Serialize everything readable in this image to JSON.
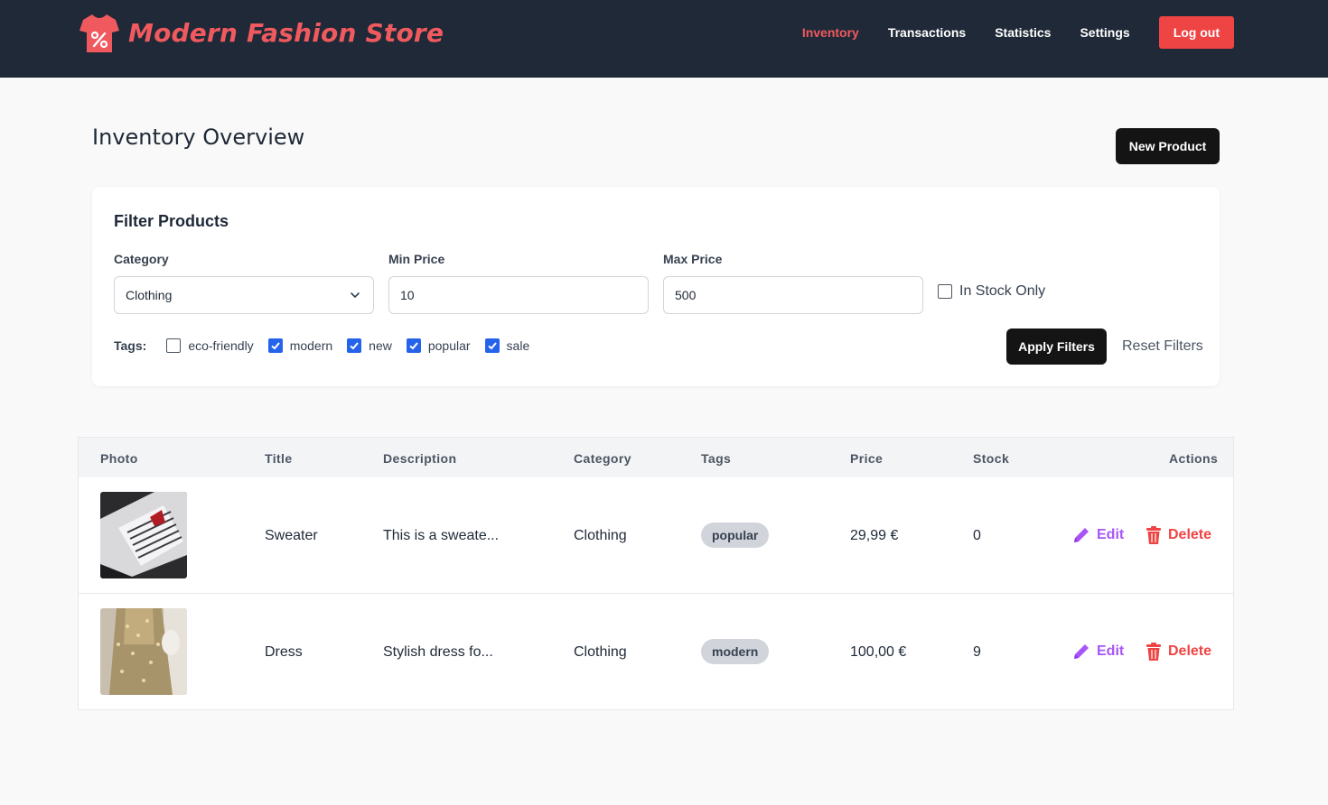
{
  "brand": {
    "name": "Modern Fashion Store",
    "accent": "#f05a5f"
  },
  "nav": {
    "items": [
      {
        "label": "Inventory",
        "active": true
      },
      {
        "label": "Transactions"
      },
      {
        "label": "Statistics"
      },
      {
        "label": "Settings"
      }
    ],
    "logout_label": "Log out"
  },
  "page": {
    "title": "Inventory Overview",
    "new_product_label": "New Product"
  },
  "filters": {
    "title": "Filter Products",
    "category": {
      "label": "Category",
      "value": "Clothing"
    },
    "min_price": {
      "label": "Min Price",
      "value": "10"
    },
    "max_price": {
      "label": "Max Price",
      "value": "500"
    },
    "in_stock": {
      "label": "In Stock Only",
      "checked": false
    },
    "tags_label": "Tags:",
    "tags": [
      {
        "label": "eco-friendly",
        "checked": false
      },
      {
        "label": "modern",
        "checked": true
      },
      {
        "label": "new",
        "checked": true
      },
      {
        "label": "popular",
        "checked": true
      },
      {
        "label": "sale",
        "checked": true
      }
    ],
    "apply_label": "Apply Filters",
    "reset_label": "Reset Filters"
  },
  "table": {
    "headers": {
      "photo": "Photo",
      "title": "Title",
      "description": "Description",
      "category": "Category",
      "tags": "Tags",
      "price": "Price",
      "stock": "Stock",
      "actions": "Actions"
    },
    "rows": [
      {
        "title": "Sweater",
        "description": "This is a sweate...",
        "category": "Clothing",
        "tag": "popular",
        "price": "29,99 €",
        "stock": "0",
        "photo": "folded-sweater"
      },
      {
        "title": "Dress",
        "description": "Stylish dress fo...",
        "category": "Clothing",
        "tag": "modern",
        "price": "100,00 €",
        "stock": "9",
        "photo": "sequin-dress"
      }
    ],
    "edit_label": "Edit",
    "delete_label": "Delete"
  },
  "colors": {
    "header_bg": "#1f2937",
    "danger": "#ef4444",
    "edit": "#a855f7",
    "checkbox": "#2563eb"
  }
}
